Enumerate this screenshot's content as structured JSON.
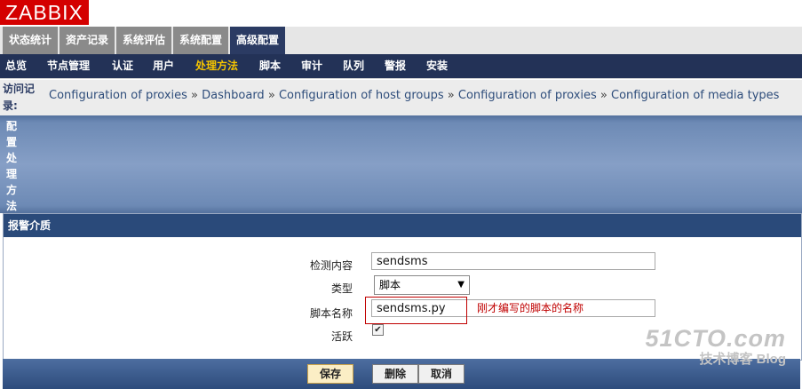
{
  "logo": "ZABBIX",
  "top_menu": [
    "状态统计",
    "资产记录",
    "系统评估",
    "系统配置",
    "高级配置"
  ],
  "top_menu_active": "高级配置",
  "sub_menu": [
    "总览",
    "节点管理",
    "认证",
    "用户",
    "处理方法",
    "脚本",
    "审计",
    "队列",
    "警报",
    "安装"
  ],
  "sub_menu_active": "处理方法",
  "breadcrumb": {
    "label": "访问记录:",
    "items": [
      "Configuration of proxies",
      "Dashboard",
      "Configuration of host groups",
      "Configuration of proxies",
      "Configuration of media types"
    ],
    "separator": "»"
  },
  "config_label": "配置处理方法",
  "form": {
    "title": "报警介质",
    "description_label": "检测内容",
    "description_value": "sendsms",
    "type_label": "类型",
    "type_value": "脚本",
    "script_label": "脚本名称",
    "script_value": "sendsms.py",
    "script_note": "刚才编写的脚本的名称",
    "active_label": "活跃",
    "active_checked": true
  },
  "buttons": {
    "save": "保存",
    "delete": "删除",
    "cancel": "取消"
  },
  "watermark": {
    "line1": "51CTO.com",
    "line2": "技术博客 Blog"
  },
  "colors": {
    "brand": "#d40000",
    "nav_dark": "#233257",
    "active_menu": "#f5c400",
    "annotation": "#c00000"
  }
}
